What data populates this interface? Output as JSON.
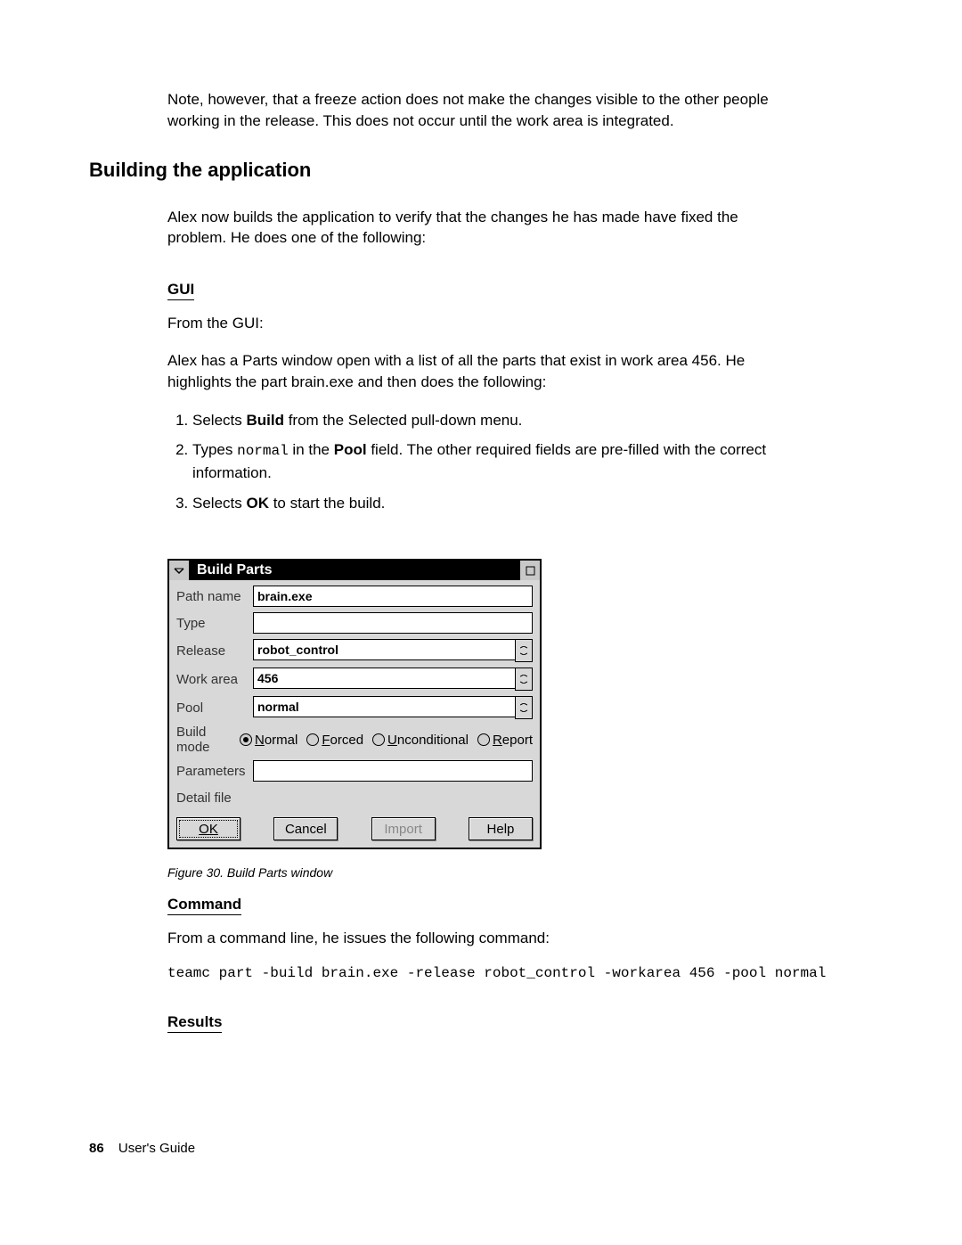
{
  "intro": "Note, however, that a freeze action does not make the changes visible to the other people working in the release. This does not occur until the work area is integrated.",
  "section_heading": "Building the application",
  "para1": "Alex now builds the application to verify that the changes he has made have fixed the problem. He does one of the following:",
  "gui_heading": "GUI",
  "gui_from": "From the GUI:",
  "gui_intro": "Alex has a Parts window open with a list of all the parts that exist in work area 456. He highlights the part brain.exe and then does the following:",
  "steps": {
    "s1_pre": "Selects ",
    "s1_bold": "Build",
    "s1_post": " from the Selected pull-down menu.",
    "s2_pre": "Types ",
    "s2_code": "normal",
    "s2_mid": " in the ",
    "s2_bold": "Pool",
    "s2_post": " field. The other required fields are pre-filled with the correct information.",
    "s3_pre": "Selects ",
    "s3_bold": "OK",
    "s3_post": " to start the build."
  },
  "dialog": {
    "title": "Build Parts",
    "labels": {
      "path_name": "Path name",
      "type": "Type",
      "release": "Release",
      "work_area": "Work area",
      "pool": "Pool",
      "build_mode": "Build mode",
      "parameters": "Parameters",
      "detail_file": "Detail file"
    },
    "values": {
      "path_name": "brain.exe",
      "type": "",
      "release": "robot_control",
      "work_area": "456",
      "pool": "normal",
      "parameters": "",
      "detail_file": ""
    },
    "build_modes": {
      "normal": "Normal",
      "forced": "Forced",
      "unconditional": "Unconditional",
      "report": "Report"
    },
    "buttons": {
      "ok": "OK",
      "cancel": "Cancel",
      "import": "Import",
      "help": "Help"
    }
  },
  "figure_caption": "Figure 30. Build Parts window",
  "command_heading": "Command",
  "command_intro": "From a command line, he issues the following command:",
  "command_line": "teamc part -build brain.exe -release robot_control -workarea 456 -pool normal",
  "results_heading": "Results",
  "footer": {
    "page_num": "86",
    "doc_title": "User's Guide"
  }
}
